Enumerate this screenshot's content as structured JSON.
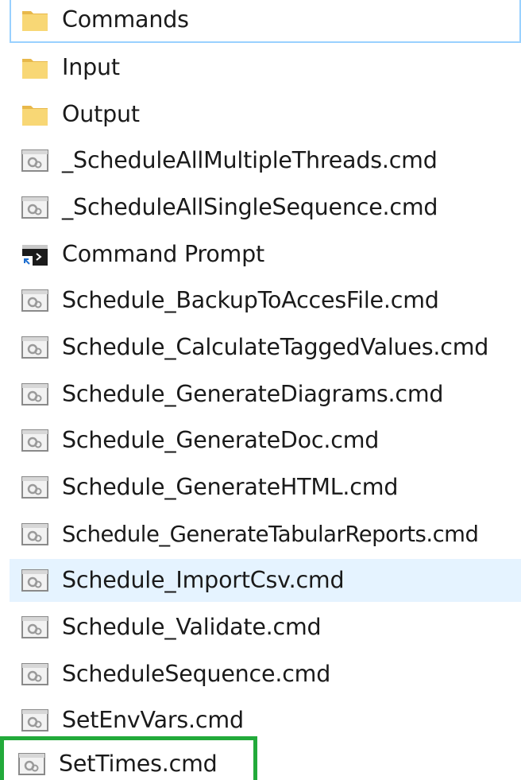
{
  "colors": {
    "selection_outline": "#22aa3a",
    "hover_background": "#e5f3ff",
    "focus_border": "#99d1ff",
    "folder_yellow": "#f8d775"
  },
  "files": [
    {
      "name": "Commands",
      "icon": "folder-icon"
    },
    {
      "name": "Input",
      "icon": "folder-icon"
    },
    {
      "name": "Output",
      "icon": "folder-icon"
    },
    {
      "name": "_ScheduleAllMultipleThreads.cmd",
      "icon": "cmd-file-icon"
    },
    {
      "name": "_ScheduleAllSingleSequence.cmd",
      "icon": "cmd-file-icon"
    },
    {
      "name": "Command Prompt",
      "icon": "command-prompt-shortcut-icon"
    },
    {
      "name": "Schedule_BackupToAccesFile.cmd",
      "icon": "cmd-file-icon"
    },
    {
      "name": "Schedule_CalculateTaggedValues.cmd",
      "icon": "cmd-file-icon"
    },
    {
      "name": "Schedule_GenerateDiagrams.cmd",
      "icon": "cmd-file-icon"
    },
    {
      "name": "Schedule_GenerateDoc.cmd",
      "icon": "cmd-file-icon"
    },
    {
      "name": "Schedule_GenerateHTML.cmd",
      "icon": "cmd-file-icon"
    },
    {
      "name": "Schedule_GenerateTabularReports.cmd",
      "icon": "cmd-file-icon"
    },
    {
      "name": "Schedule_ImportCsv.cmd",
      "icon": "cmd-file-icon"
    },
    {
      "name": "Schedule_Validate.cmd",
      "icon": "cmd-file-icon"
    },
    {
      "name": "ScheduleSequence.cmd",
      "icon": "cmd-file-icon"
    },
    {
      "name": "SetEnvVars.cmd",
      "icon": "cmd-file-icon"
    },
    {
      "name": "SetTimes.cmd",
      "icon": "cmd-file-icon"
    }
  ]
}
